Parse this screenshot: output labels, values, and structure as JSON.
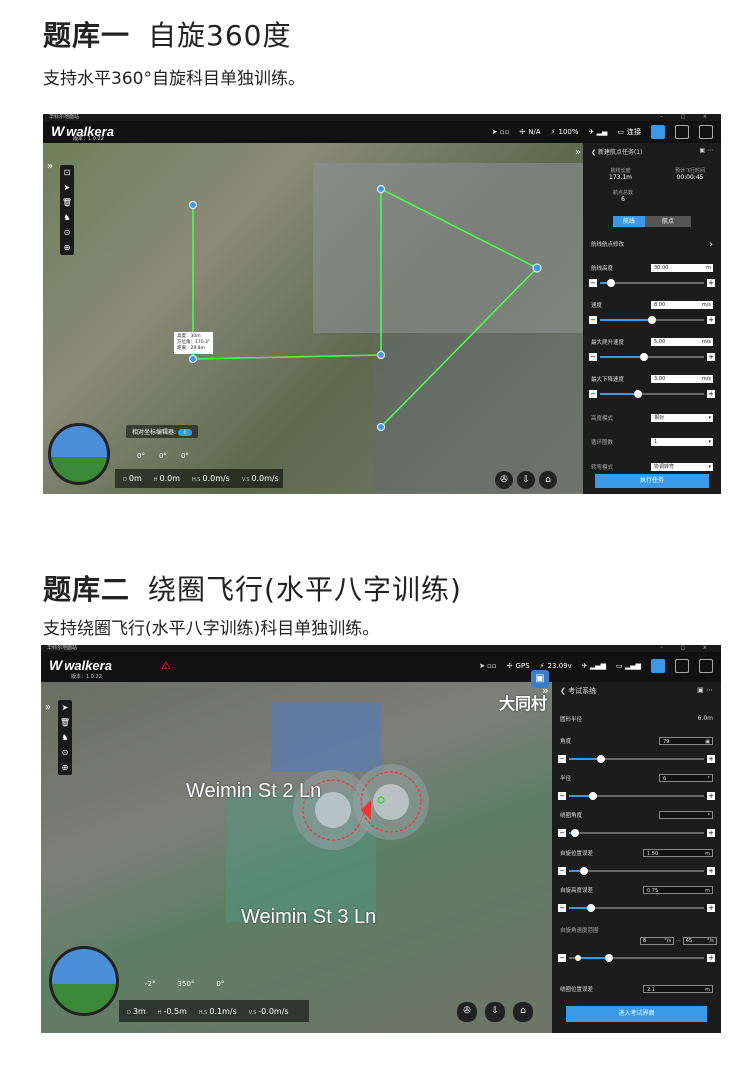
{
  "section1": {
    "title_main": "题库一",
    "title_sub": "自旋360度",
    "description": "支持水平360°自旋科目单独训练。",
    "window_title": "华科尔地面站",
    "app": {
      "logo": "walkera",
      "version": "版本：1.0.22"
    },
    "topbar": {
      "gps": "N/A",
      "battery": "100%",
      "connect": "连接"
    },
    "panel": {
      "title": "新建航点任务(1)",
      "route_length_label": "航线长度",
      "route_length": "173.1m",
      "flight_time_label": "预计飞行时间",
      "flight_time": "00:00:45",
      "waypoints_label": "航点总数",
      "waypoints": "6",
      "tab_route": "航线",
      "tab_point": "航点",
      "batch_edit": "航线航点修改",
      "altitude_label": "航线高度",
      "altitude": "30.00",
      "altitude_unit": "m",
      "speed_label": "速度",
      "speed": "8.00",
      "speed_unit": "m/s",
      "climb_label": "最大爬升速度",
      "climb": "5.00",
      "climb_unit": "m/s",
      "descent_label": "最大下降速度",
      "descent": "3.00",
      "descent_unit": "m/s",
      "height_mode_label": "高度模式",
      "height_mode": "相对",
      "loops_label": "循环圈数",
      "loops": "1",
      "heading_mode_label": "转弯模式",
      "heading_mode": "协调转弯",
      "execute": "执行任务"
    },
    "map": {
      "toggle_label": "相对坐标编辑器",
      "toggle_value": "I",
      "popup": [
        "高度：30m",
        "方位角：170.3°",
        "距离：29.8m"
      ],
      "angles": [
        "0°",
        "0°",
        "0°"
      ]
    },
    "status": {
      "d_label": "D",
      "d": "0m",
      "h_label": "H",
      "h": "0.0m",
      "hs_label": "H.S",
      "hs": "0.0m/s",
      "vs_label": "V.S",
      "vs": "0.0m/s"
    }
  },
  "section2": {
    "title_main": "题库二",
    "title_sub": "绕圈飞行(水平八字训练)",
    "description": "支持绕圈飞行(水平八字训练)科目单独训练。",
    "window_title": "华科尔地面站",
    "app": {
      "logo": "walkera",
      "version": "版本：1.0.22"
    },
    "topbar": {
      "gps": "GPS",
      "battery": "23.09v"
    },
    "panel": {
      "title": "考试系统",
      "radius_label": "圆形半径",
      "radius": "6.0m",
      "angle_label": "角度",
      "angle": "79",
      "r_label": "半径",
      "r": "6",
      "r_unit": "°",
      "ground_angle_label": "绕圈角度",
      "ground_angle": "",
      "ground_angle_unit": "°",
      "spin_err_label": "自旋位置误差",
      "spin_err": "1.50",
      "spin_err_unit": "m",
      "spin_h_label": "自旋高度误差",
      "spin_h": "0.75",
      "spin_h_unit": "m",
      "spin_speed_label": "自旋角速度范围",
      "spin_min": "8",
      "spin_min_unit": "°/s",
      "spin_sep": "...",
      "spin_max": "45",
      "spin_max_unit": "°/s",
      "circle_err_label": "绕圈位置误差",
      "circle_err": "2.1",
      "circle_err_unit": "m",
      "enter": "进入考试界面"
    },
    "map": {
      "street1": "Weimin St 2 Ln",
      "street2": "Weimin St 3 Ln",
      "poi": "大同村",
      "angles": [
        "-2°",
        "350°",
        "0°"
      ]
    },
    "status": {
      "d_label": "D",
      "d": "3m",
      "h_label": "H",
      "h": "-0.5m",
      "hs_label": "H.S",
      "hs": "0.1m/s",
      "vs_label": "V.S",
      "vs": "-0.0m/s"
    }
  }
}
